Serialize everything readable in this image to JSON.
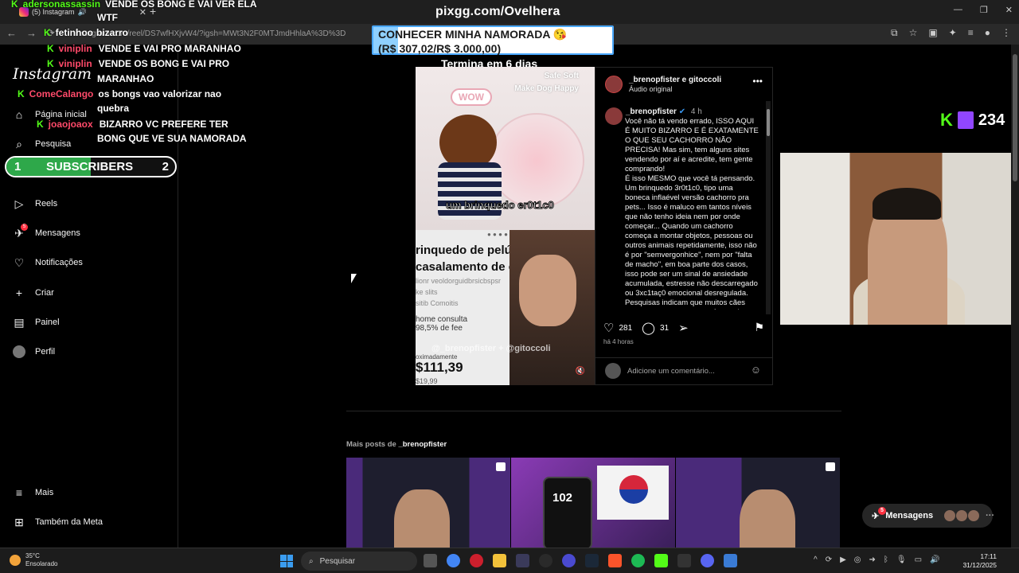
{
  "browser": {
    "tab_title": "(5) Instagram",
    "url": "instagram.com/reel/DS7wfHXjvW4/?igsh=MWt3N2F0MTJmdHhlaA%3D%3D"
  },
  "stream": {
    "site": "pixgg.com/Ovelhera",
    "goal_title": "CONHECER MINHA NAMORADA 😘",
    "goal_amount": "(R$ 307,02/R$ 3.000,00)",
    "goal_progress": 0.1023,
    "timer": "Termina em 6 dias",
    "viewers": "234"
  },
  "chat": [
    {
      "user": "adersonassassin",
      "message": "VENDE OS BONG E VAI VER ELA"
    },
    {
      "user": "",
      "message": "WTF"
    },
    {
      "user": "fetinhoo",
      "message": "bizarro"
    },
    {
      "user": "viniplin",
      "message": "VENDE E VAI PRO MARANHAO"
    },
    {
      "user": "viniplin",
      "message": "VENDE OS BONG E VAI PRO"
    },
    {
      "user": "",
      "message": "MARANHAO"
    },
    {
      "user": "ComeCalango",
      "message": "os bongs vao valorizar nao"
    },
    {
      "user": "",
      "message": "quebra"
    },
    {
      "user": "joaojoaox",
      "message": "BIZARRO VC PREFERE TER"
    },
    {
      "user": "",
      "message": "BONG QUE VE SUA NAMORADA"
    }
  ],
  "subs": {
    "left": "1",
    "label": "SUBSCRIBERS",
    "right": "2",
    "progress": 0.5
  },
  "sidebar": {
    "logo": "Instagram",
    "items": [
      {
        "label": "Página inicial",
        "icon": "home-icon"
      },
      {
        "label": "Pesquisa",
        "icon": "search-icon"
      },
      {
        "label": "Reels",
        "icon": "reels-icon"
      },
      {
        "label": "Mensagens",
        "icon": "messenger-icon",
        "badge": "5"
      },
      {
        "label": "Notificações",
        "icon": "heart-icon"
      },
      {
        "label": "Criar",
        "icon": "plus-icon"
      },
      {
        "label": "Painel",
        "icon": "dashboard-icon"
      },
      {
        "label": "Perfil",
        "icon": "avatar"
      },
      {
        "label": "Mais",
        "icon": "menu-icon"
      },
      {
        "label": "Também da Meta",
        "icon": "meta-icon"
      }
    ]
  },
  "post": {
    "header_names": "_brenopfister e gitoccoli",
    "header_audio": "Áudio original",
    "author": "_brenopfister",
    "time": "4 h",
    "caption": "Você não tá vendo errado, ISSO AQUI É MUITO BIZARRO E É EXATAMENTE O QUE SEU CACHORRO NÃO PRECISA! Mas sim, tem alguns sites vendendo por aí e acredite, tem gente comprando!\nÉ isso MESMO que você tá pensando. Um brinquedo 3r0t1c0, tipo uma boneca inflaével versão cachorro pra pets... Isso é maluco em tantos níveis que não tenho ideia nem por onde começar... Quando um cachorro começa a montar objetos, pessoas ou outros animais repetidamente, isso não é por \"semvergonhice\", nem por \"falta de macho\", em boa parte dos casos, isso pode ser um sinal de ansiedade acumulada, estresse não descarregado ou 3xc1taç0 emocional desregulada. Pesquisas indicam que muitos cães usam esse ato como uma forma de",
    "likes": "281",
    "comments": "31",
    "ago": "há 4 horas",
    "comment_placeholder": "Adicione um comentário...",
    "media": {
      "wow": "WOW",
      "tagline_1": "Safe Soft",
      "tagline_2": "Make Dog Happy",
      "caption": "um brinquedo er0t1c0",
      "big_text": "rinquedo de pelúc... ara casalamento de c... cho",
      "sub_text_1": "lionr veoldorguidbrsicbspsr",
      "sub_text_2": "ke slits",
      "sub_text_3": "sitib Comoitis",
      "home": "home consulta",
      "rating": "98,5% de fee",
      "approx": "oximadamente",
      "price": "$111,39",
      "old_price": "$19,99",
      "watermark": "@_brenopfister + @gitoccoli"
    }
  },
  "more_posts": {
    "prefix": "Mais posts de",
    "user": "_brenopfister",
    "phone_value": "102"
  },
  "messages_pill": {
    "label": "Mensagens",
    "badge": "5"
  },
  "taskbar": {
    "weather_temp": "35°C",
    "weather_desc": "Ensolarado",
    "search": "Pesquisar",
    "time": "17:11",
    "date": "31/12/2025"
  },
  "colors": {
    "kick": "#53fc18",
    "twitch": "#9146ff",
    "ig_badge": "#ff3040"
  }
}
